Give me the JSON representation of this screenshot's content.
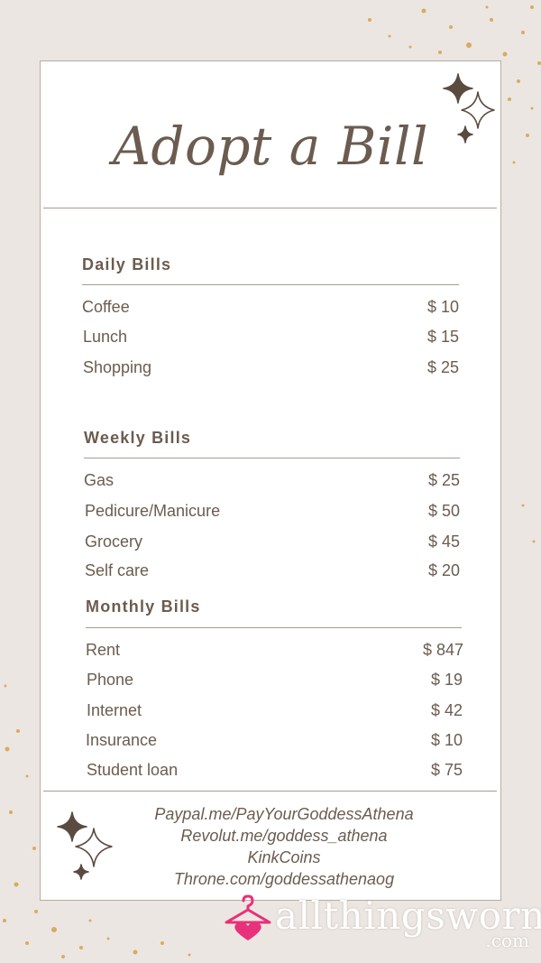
{
  "title": "Adopt a Bill",
  "sections": [
    {
      "heading": "Daily Bills",
      "items": [
        {
          "name": "Coffee",
          "price": "$ 10"
        },
        {
          "name": "Lunch",
          "price": "$ 15"
        },
        {
          "name": "Shopping",
          "price": "$ 25"
        }
      ]
    },
    {
      "heading": "Weekly Bills",
      "items": [
        {
          "name": "Gas",
          "price": "$ 25"
        },
        {
          "name": "Pedicure/Manicure",
          "price": "$ 50"
        },
        {
          "name": "Grocery",
          "price": "$ 45"
        },
        {
          "name": "Self care",
          "price": "$ 20"
        }
      ]
    },
    {
      "heading": "Monthly Bills",
      "items": [
        {
          "name": "Rent",
          "price": "$ 847"
        },
        {
          "name": "Phone",
          "price": "$ 19"
        },
        {
          "name": "Internet",
          "price": "$ 42"
        },
        {
          "name": "Insurance",
          "price": "$ 10"
        },
        {
          "name": "Student loan",
          "price": "$ 75"
        }
      ]
    }
  ],
  "payment_links": [
    "Paypal.me/PayYourGoddessAthena",
    "Revolut.me/goddess_athena",
    "KinkCoins",
    "Throne.com/goddessathenaog"
  ],
  "brand": {
    "name": "allthingsworn",
    "suffix": ".com",
    "icon": "hanger-heart-icon",
    "icon_color": "#e8317a"
  },
  "colors": {
    "background": "#ece6e2",
    "card": "#ffffff",
    "text": "#6b5c4f",
    "sparkle_gold": "#d4a24a"
  }
}
